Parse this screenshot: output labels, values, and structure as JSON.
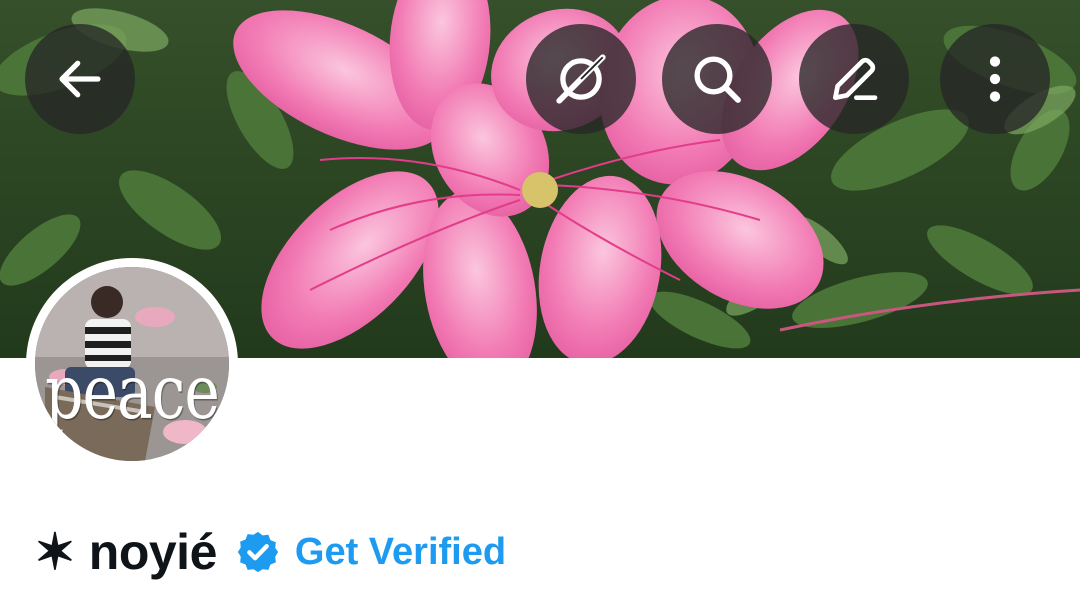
{
  "header": {
    "back_icon": "arrow-left-icon",
    "grok_icon": "grok-icon",
    "search_icon": "search-icon",
    "edit_icon": "pencil-icon",
    "more_icon": "more-vertical-icon",
    "button_bg": "#262626"
  },
  "avatar": {
    "overlay_text": "peace"
  },
  "profile": {
    "display_name": "✶ noyié",
    "verified_badge_icon": "verified-badge-icon",
    "get_verified_label": "Get Verified"
  },
  "colors": {
    "accent": "#1d9bf0",
    "name_text": "#0f1419",
    "banner_flower": "#f06aa9"
  }
}
